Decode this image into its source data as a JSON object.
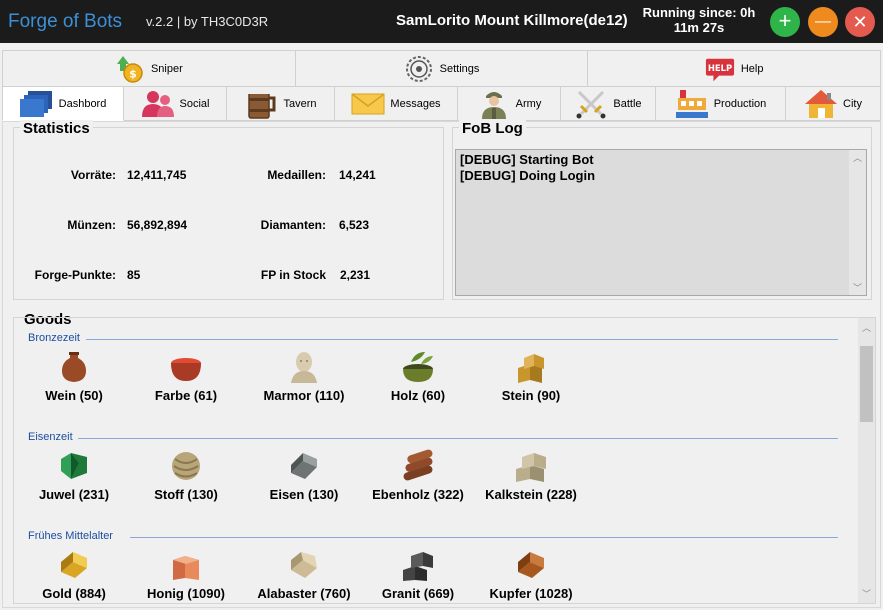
{
  "titlebar": {
    "app_name": "Forge of Bots",
    "version": "v.2.2 | by TH3C0D3R",
    "account": "SamLorito Mount Killmore(de12)",
    "running_line1": "Running since: 0h",
    "running_line2": "11m 27s",
    "add_glyph": "+",
    "min_glyph": "—",
    "close_glyph": "✕"
  },
  "tabs_top": [
    {
      "label": "Sniper",
      "icon": "coin-arrow-icon"
    },
    {
      "label": "Settings",
      "icon": "gear-icon"
    },
    {
      "label": "Help",
      "icon": "help-bubble-icon"
    }
  ],
  "tabs_main": [
    {
      "label": "Dashbord",
      "icon": "dashboard-icon",
      "active": true
    },
    {
      "label": "Social",
      "icon": "people-icon"
    },
    {
      "label": "Tavern",
      "icon": "beer-mug-icon"
    },
    {
      "label": "Messages",
      "icon": "envelope-icon"
    },
    {
      "label": "Army",
      "icon": "soldier-icon"
    },
    {
      "label": "Battle",
      "icon": "crossed-swords-icon"
    },
    {
      "label": "Production",
      "icon": "factory-icon"
    },
    {
      "label": "City",
      "icon": "house-icon"
    }
  ],
  "statistics": {
    "title": "Statistics",
    "items": [
      {
        "label": "Vorräte:",
        "value": "12,411,745"
      },
      {
        "label": "Medaillen:",
        "value": "14,241"
      },
      {
        "label": "Münzen:",
        "value": "56,892,894"
      },
      {
        "label": "Diamanten:",
        "value": "6,523"
      },
      {
        "label": "Forge-Punkte:",
        "value": "85"
      },
      {
        "label": "FP in Stock",
        "value": "2,231"
      }
    ]
  },
  "log": {
    "title": "FoB Log",
    "lines": [
      "[DEBUG] Starting Bot",
      "[DEBUG] Doing Login"
    ]
  },
  "goods": {
    "title": "Goods",
    "eras": [
      {
        "name": "Bronzezeit",
        "items": [
          {
            "label": "Wein (50)",
            "icon": "wine-jug-icon",
            "color": "#9a4a26"
          },
          {
            "label": "Farbe (61)",
            "icon": "dye-bowl-icon",
            "color": "#c0392b"
          },
          {
            "label": "Marmor (110)",
            "icon": "marble-bust-icon",
            "color": "#d9cbb0"
          },
          {
            "label": "Holz (60)",
            "icon": "wood-bowl-icon",
            "color": "#6b7d2a"
          },
          {
            "label": "Stein (90)",
            "icon": "stone-blocks-icon",
            "color": "#c9962e"
          }
        ]
      },
      {
        "name": "Eisenzeit",
        "items": [
          {
            "label": "Juwel (231)",
            "icon": "jewel-icon",
            "color": "#1f7a3a"
          },
          {
            "label": "Stoff (130)",
            "icon": "cloth-roll-icon",
            "color": "#b8a579"
          },
          {
            "label": "Eisen (130)",
            "icon": "iron-ingot-icon",
            "color": "#6e7474"
          },
          {
            "label": "Ebenholz (322)",
            "icon": "ebony-logs-icon",
            "color": "#7a3e22"
          },
          {
            "label": "Kalkstein (228)",
            "icon": "limestone-icon",
            "color": "#b9ad8c"
          }
        ]
      },
      {
        "name": "Frühes Mittelalter",
        "items": [
          {
            "label": "Gold (884)",
            "icon": "gold-bar-icon",
            "color": "#d8a623"
          },
          {
            "label": "Honig (1090)",
            "icon": "honey-crate-icon",
            "color": "#cf6a43"
          },
          {
            "label": "Alabaster (760)",
            "icon": "alabaster-icon",
            "color": "#cdbb95"
          },
          {
            "label": "Granit (669)",
            "icon": "granite-icon",
            "color": "#444444"
          },
          {
            "label": "Kupfer (1028)",
            "icon": "copper-bar-icon",
            "color": "#a8581e"
          }
        ]
      }
    ]
  },
  "colors": {
    "titlebar_bg": "#1b1b1b",
    "app_name": "#3d8fd6",
    "era_text": "#1d4ea0",
    "add_button": "#2fb44a",
    "min_button": "#ef8a1f",
    "close_button": "#e45a4e"
  }
}
